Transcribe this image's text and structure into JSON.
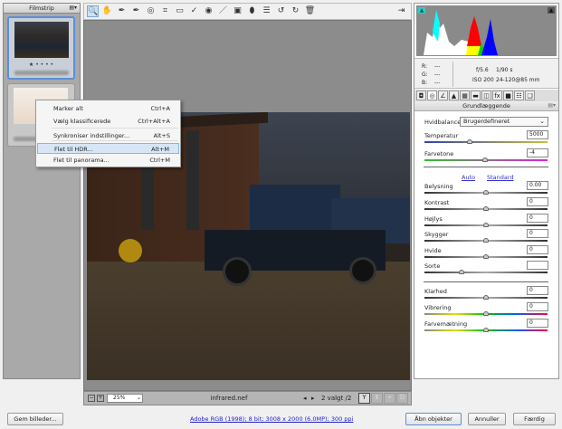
{
  "filmstrip": {
    "title": "Filmstrip",
    "thumbnails": [
      {
        "rating": "★ • • • •",
        "selected": true
      },
      {
        "rating": "★ •",
        "selected": false
      }
    ]
  },
  "toolbar": {
    "tools": [
      {
        "icon": "zoom-icon",
        "glyph": "🔍",
        "active": true
      },
      {
        "icon": "hand-icon",
        "glyph": "✋"
      },
      {
        "icon": "white-balance-icon",
        "glyph": "✒"
      },
      {
        "icon": "color-sampler-icon",
        "glyph": "✒"
      },
      {
        "icon": "targeted-adjustment-icon",
        "glyph": "◎"
      },
      {
        "icon": "crop-icon",
        "glyph": "⌗"
      },
      {
        "icon": "straighten-icon",
        "glyph": "▭"
      },
      {
        "icon": "spot-removal-icon",
        "glyph": "✓"
      },
      {
        "icon": "red-eye-icon",
        "glyph": "◉"
      },
      {
        "icon": "adjustment-brush-icon",
        "glyph": "／"
      },
      {
        "icon": "graduated-filter-icon",
        "glyph": "▣"
      },
      {
        "icon": "radial-filter-icon",
        "glyph": "⬮"
      },
      {
        "icon": "list-icon",
        "glyph": "☰"
      },
      {
        "icon": "rotate-left-icon",
        "glyph": "↺"
      },
      {
        "icon": "rotate-right-icon",
        "glyph": "↻"
      },
      {
        "icon": "trash-icon",
        "glyph": "🗑"
      }
    ],
    "fullscreen_icon": "fullscreen-icon"
  },
  "context_menu": {
    "items": [
      {
        "label": "Marker alt",
        "shortcut": "Ctrl+A"
      },
      {
        "label": "Vælg klassificerede",
        "shortcut": "Ctrl+Alt+A"
      },
      {
        "label": "Synkroniser indstillinger...",
        "shortcut": "Alt+S"
      },
      {
        "label": "Flet til HDR...",
        "shortcut": "Alt+M",
        "highlighted": true
      },
      {
        "label": "Flet til panorama...",
        "shortcut": "Ctrl+M"
      }
    ]
  },
  "statusbar": {
    "zoom": "25%",
    "filename": "infrared.nef",
    "selection": "2 valgt /2"
  },
  "info": {
    "r_label": "R:",
    "g_label": "G:",
    "b_label": "B:",
    "r": "---",
    "g": "---",
    "b": "---",
    "aperture": "f/5.6",
    "shutter": "1/90 s",
    "iso": "ISO 200",
    "lens": "24-120@85 mm"
  },
  "panel": {
    "title": "Grundlæggende",
    "wb_label": "Hvidbalance:",
    "wb_value": "Brugerdefineret",
    "auto": "Auto",
    "standard": "Standard",
    "sliders": [
      {
        "label": "Temperatur",
        "value": "5000",
        "level": 0.37,
        "track": "temp"
      },
      {
        "label": "Farvetone",
        "value": "-4",
        "level": 0.49,
        "track": "tint"
      },
      {
        "label": "Belysning",
        "value": "0.00",
        "level": 0.5,
        "track": "gray"
      },
      {
        "label": "Kontrast",
        "value": "0",
        "level": 0.5,
        "track": "gray"
      },
      {
        "label": "Højlys",
        "value": "0",
        "level": 0.5,
        "track": "gray"
      },
      {
        "label": "Skygger",
        "value": "0",
        "level": 0.5,
        "track": "gray"
      },
      {
        "label": "Hvide",
        "value": "0",
        "level": 0.5,
        "track": "gray"
      },
      {
        "label": "Sorte",
        "value": "",
        "level": 0.3,
        "track": "gray"
      },
      {
        "label": "Klarhed",
        "value": "0",
        "level": 0.5,
        "track": "gray"
      },
      {
        "label": "Vibrering",
        "value": "0",
        "level": 0.5,
        "track": "rainbow"
      },
      {
        "label": "Farvemætning",
        "value": "0",
        "level": 0.5,
        "track": "rainbow"
      }
    ]
  },
  "footer": {
    "save": "Gem billeder...",
    "workflow": "Adobe RGB (1998); 8 bit; 3008 x 2000 (6.0MP); 300 ppi",
    "open": "Åbn objekter",
    "cancel": "Annuller",
    "done": "Færdig"
  }
}
